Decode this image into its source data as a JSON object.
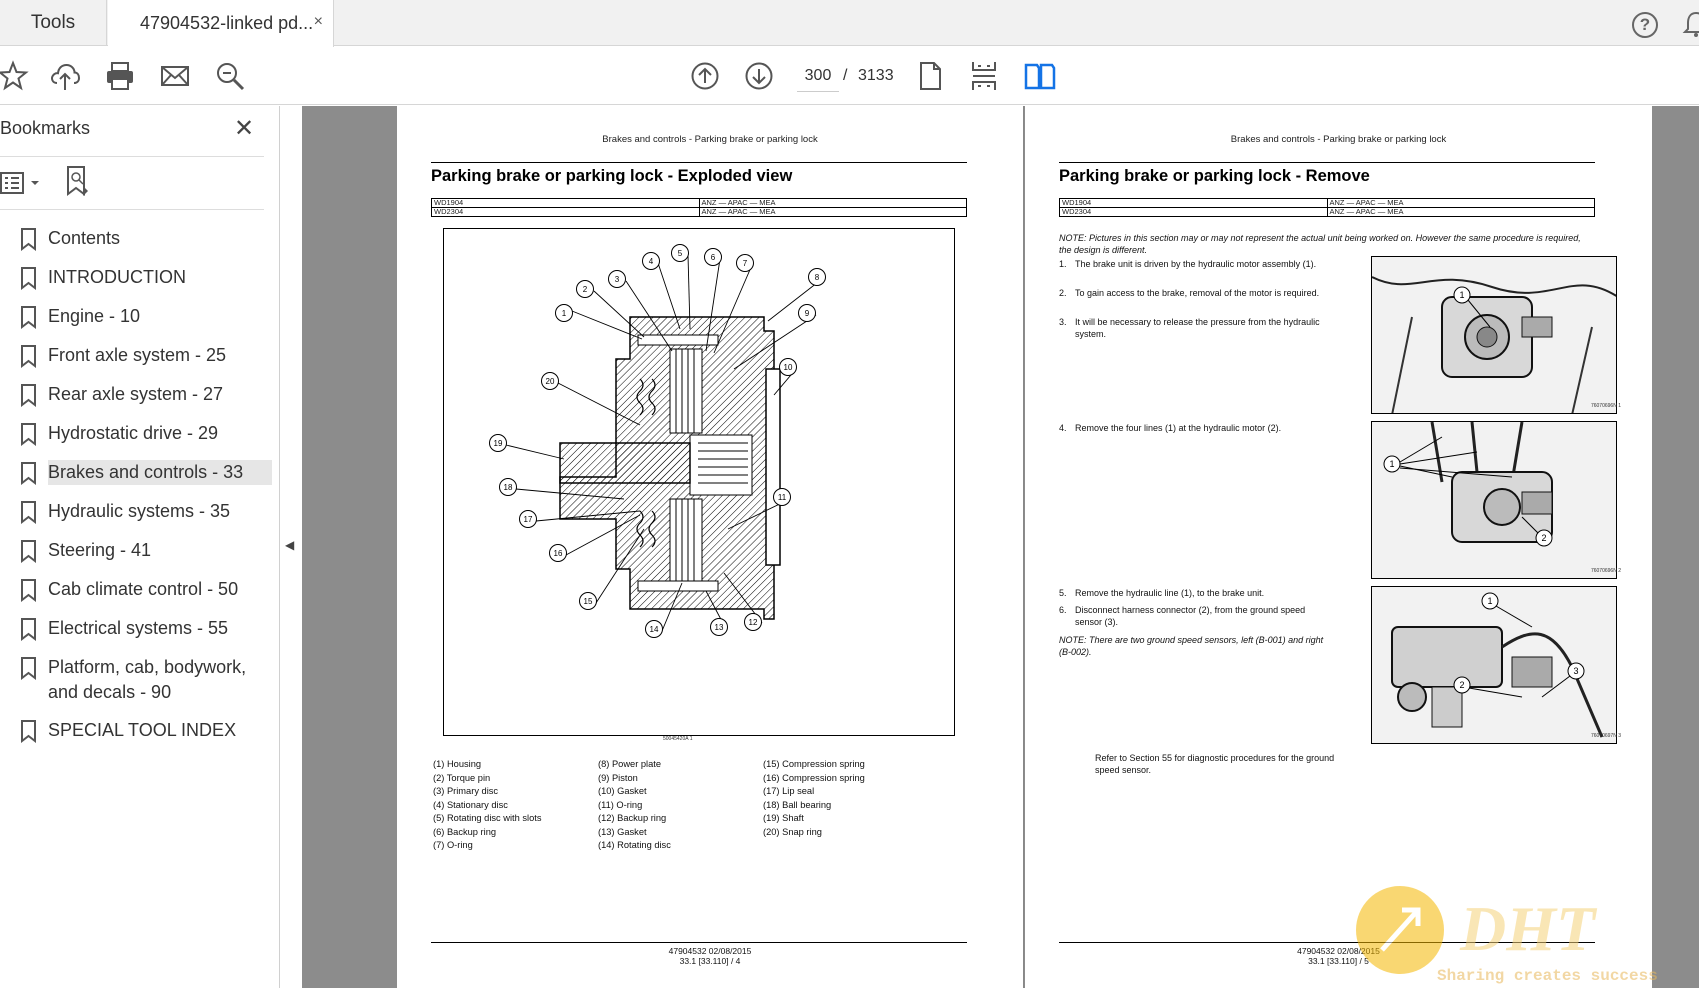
{
  "tabs": {
    "tools": "Tools",
    "document": "47904532-linked pd...",
    "close": "×"
  },
  "toolbar": {
    "current_page": "300",
    "separator": "/",
    "total_pages": "3133"
  },
  "sidebar": {
    "title": "Bookmarks",
    "close": "✕",
    "items": [
      {
        "label": "Contents"
      },
      {
        "label": "INTRODUCTION"
      },
      {
        "label": "Engine - 10"
      },
      {
        "label": "Front axle system - 25"
      },
      {
        "label": "Rear axle system - 27"
      },
      {
        "label": "Hydrostatic drive - 29"
      },
      {
        "label": "Brakes and controls - 33",
        "selected": true
      },
      {
        "label": "Hydraulic systems - 35"
      },
      {
        "label": "Steering - 41"
      },
      {
        "label": "Cab climate control - 50"
      },
      {
        "label": "Electrical systems - 55"
      },
      {
        "label": "Platform, cab, bodywork, and decals - 90"
      },
      {
        "label": "SPECIAL TOOL INDEX"
      }
    ]
  },
  "left_page": {
    "header": "Brakes and controls - Parking brake or parking lock",
    "title": "Parking brake or parking lock - Exploded view",
    "models": [
      {
        "model": "WD1904",
        "regions": "ANZ — APAC — MEA"
      },
      {
        "model": "WD2304",
        "regions": "ANZ — APAC — MEA"
      }
    ],
    "diagram_caption": "50045420A   1",
    "callouts": [
      "1",
      "2",
      "3",
      "4",
      "5",
      "6",
      "7",
      "8",
      "9",
      "10",
      "11",
      "12",
      "13",
      "14",
      "15",
      "16",
      "17",
      "18",
      "19",
      "20"
    ],
    "legend": [
      [
        "(1) Housing",
        "(2) Torque pin",
        "(3) Primary disc",
        "(4) Stationary disc",
        "(5) Rotating disc with slots",
        "(6) Backup ring",
        "(7) O-ring"
      ],
      [
        "(8) Power plate",
        "(9) Piston",
        "(10) Gasket",
        "(11) O-ring",
        "(12) Backup ring",
        "(13) Gasket",
        "(14) Rotating disc"
      ],
      [
        "(15) Compression spring",
        "(16) Compression spring",
        "(17) Lip seal",
        "(18) Ball bearing",
        "(19) Shaft",
        "(20) Snap ring"
      ]
    ],
    "footer_line1": "47904532 02/08/2015",
    "footer_line2": "33.1 [33.110] / 4"
  },
  "right_page": {
    "header": "Brakes and controls - Parking brake or parking lock",
    "title": "Parking brake or parking lock - Remove",
    "models": [
      {
        "model": "WD1904",
        "regions": "ANZ — APAC — MEA"
      },
      {
        "model": "WD2304",
        "regions": "ANZ — APAC — MEA"
      }
    ],
    "note1": "NOTE: Pictures in this section may or may not represent the actual unit being worked on. However the same procedure is required, the design is different.",
    "steps": [
      {
        "num": "1.",
        "text": "The brake unit is driven by the hydraulic motor assembly (1)."
      },
      {
        "num": "2.",
        "text": "To gain access to the brake, removal of the motor is required."
      },
      {
        "num": "3.",
        "text": "It will be necessary to release the pressure from the hydraulic system."
      },
      {
        "num": "4.",
        "text": "Remove the four lines (1) at the hydraulic motor (2)."
      },
      {
        "num": "5.",
        "text": "Remove the hydraulic line (1), to the brake unit."
      },
      {
        "num": "6.",
        "text": "Disconnect harness connector (2), from the ground speed sensor (3)."
      }
    ],
    "note2": "NOTE: There are two ground speed sensors, left (B-001) and right (B-002).",
    "refer": "Refer to Section 55 for diagnostic procedures for the ground speed sensor.",
    "photo_captions": [
      "76070696N   1",
      "76070696N   2",
      "76070697N   3"
    ],
    "photo_callouts": {
      "photo1": [
        "1"
      ],
      "photo2": [
        "1",
        "2"
      ],
      "photo3": [
        "1",
        "2",
        "3"
      ]
    },
    "footer_line1": "47904532 02/08/2015",
    "footer_line2": "33.1 [33.110] / 5"
  },
  "watermark": {
    "logo": "DHT",
    "tagline": "Sharing creates success"
  },
  "colors": {
    "accent_blue": "#1473e6",
    "sidebar_selected": "#e6e6e6",
    "doc_background": "#8c8c8c"
  }
}
